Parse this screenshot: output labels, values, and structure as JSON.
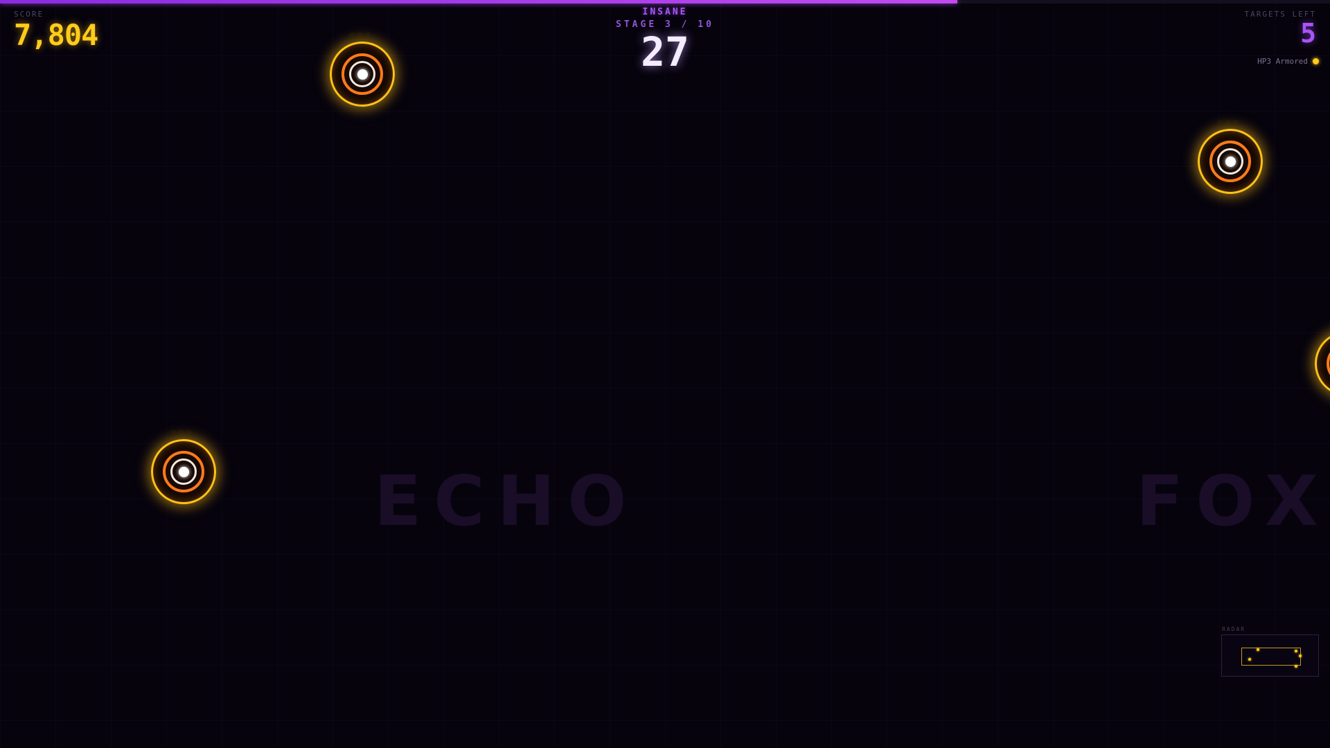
{
  "hud": {
    "score_label": "SCORE",
    "score_value": "7,804",
    "targets_label": "TARGETS LEFT",
    "targets_value": "5",
    "difficulty": "INSANE",
    "stage": "STAGE 3 / 10",
    "timer": "27",
    "legend_text": "HP3 Armored",
    "progress": 0.72
  },
  "zones": {
    "left": "ECHO",
    "right": "FOX"
  },
  "targets": [
    {
      "hp": "❤❤❤",
      "type": "armored",
      "hp_value": 3
    },
    {
      "hp": "❤❤❤",
      "type": "armored",
      "hp_value": 3
    },
    {
      "hp": "❤❤❤",
      "type": "armored",
      "hp_value": 3
    },
    {
      "hp": "",
      "type": "armored",
      "hp_value": 3
    }
  ],
  "radar": {
    "label": "RADAR",
    "dot_count": 5
  },
  "colors": {
    "score": "#ffcc1a",
    "accent": "#a855f7",
    "target_ring": "#ffc21a",
    "target_inner": "#ff7a1a"
  }
}
